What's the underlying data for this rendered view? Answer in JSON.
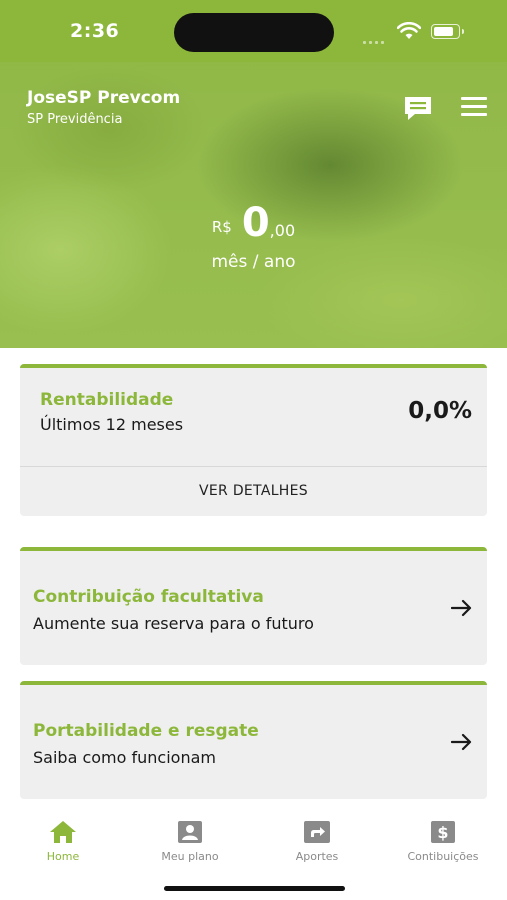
{
  "status_bar": {
    "time": "2:36",
    "battery_level": 0.85
  },
  "header": {
    "user_name": "JoseSP Prevcom",
    "organization": "SP Previdência",
    "icons": [
      "chat-icon",
      "menu-icon"
    ]
  },
  "balance": {
    "currency": "R$",
    "integer": "0",
    "decimal": ",00",
    "period": "mês / ano"
  },
  "rentabilidade": {
    "title": "Rentabilidade",
    "subtitle": "Últimos 12 meses",
    "value": "0,0%",
    "details_label": "VER DETALHES"
  },
  "cards": [
    {
      "title": "Contribuição facultativa",
      "subtitle": "Aumente sua reserva para o futuro",
      "icon": "arrow-right-icon"
    },
    {
      "title": "Portabilidade e resgate",
      "subtitle": "Saiba como funcionam",
      "icon": "arrow-right-icon"
    }
  ],
  "tabs": [
    {
      "label": "Home",
      "icon": "home-icon",
      "active": true
    },
    {
      "label": "Meu plano",
      "icon": "person-icon",
      "active": false
    },
    {
      "label": "Aportes",
      "icon": "transfer-icon",
      "active": false
    },
    {
      "label": "Contibuições",
      "icon": "dollar-icon",
      "active": false
    }
  ],
  "colors": {
    "accent": "#8cb73a",
    "card_bg": "#efefef",
    "inactive_tab": "#8a8a8a"
  }
}
